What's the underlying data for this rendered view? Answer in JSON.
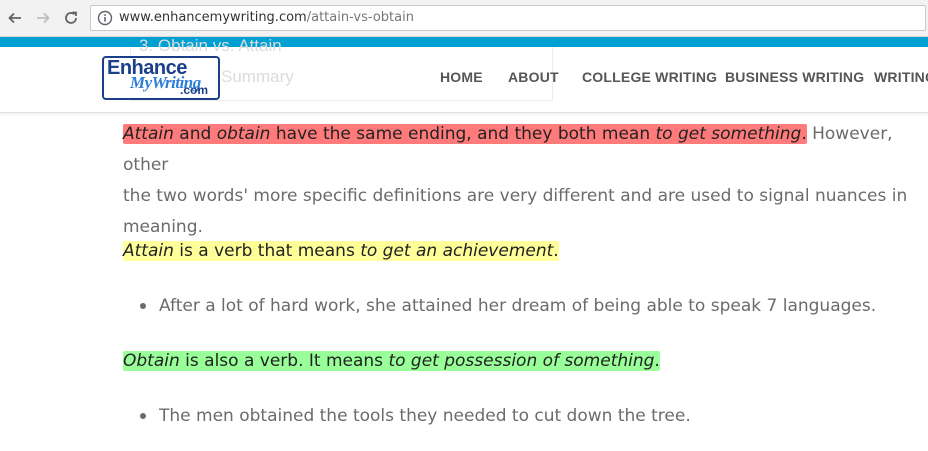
{
  "browser": {
    "url_domain": "www.enhancemywriting.com",
    "url_path": "/attain-vs-obtain"
  },
  "colors": {
    "accent_bar": "#00a0d2",
    "logo_blue": "#1b3f8b",
    "highlight_red": "#ff7b7b",
    "highlight_yellow": "#ffff99",
    "highlight_green": "#99ff99"
  },
  "site": {
    "logo": {
      "line1": "Enhance",
      "line2": "MyWriting",
      "line3": ".com"
    },
    "ghost_dropdown": {
      "item1": "3. Obtain vs. Attain",
      "item2": "Summary"
    },
    "menu": [
      "HOME",
      "ABOUT",
      "COLLEGE WRITING",
      "BUSINESS WRITING",
      "WRITING"
    ]
  },
  "article": {
    "p1": {
      "w1": "Attain",
      "w2": " and ",
      "w3": "obtain",
      "w4": " have the same ending, and they both mean ",
      "w5": "to get something",
      "w6": ".",
      "rest_line1": " However, other",
      "line2": "the two words' more specific definitions are very different and are used to signal nuances in",
      "line3": "meaning."
    },
    "p2": {
      "w1": "Attain",
      "w2": " is a verb that means ",
      "w3": "to get an achievement",
      "w4": "."
    },
    "bullet1": "After a lot of hard work, she attained her dream of being able to speak 7 languages.",
    "p3": {
      "w1": "Obtain",
      "w2": " is also a verb. It means ",
      "w3": "to get possession of something",
      "w4": "."
    },
    "bullet2": "The men obtained the tools they needed to cut down the tree."
  }
}
